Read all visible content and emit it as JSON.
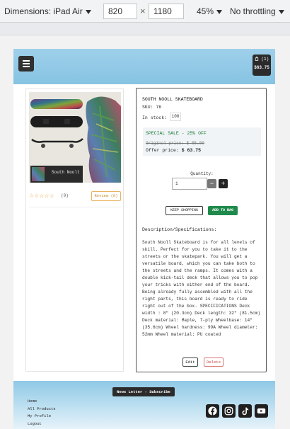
{
  "devtools": {
    "device": "Dimensions: iPad Air",
    "width": "820",
    "separator": "×",
    "height": "1180",
    "zoom": "45%",
    "throttling": "No throttling"
  },
  "header": {
    "cart_count": "(1)",
    "cart_total": "$63.75"
  },
  "product": {
    "image_brand": "South Noolt",
    "rating_count": "(0)",
    "review_button": "Review (0)",
    "name": "SOUTH NOOLL SKATEBOARD",
    "sku": "SKU: 76",
    "stock_label": "In stock:",
    "stock_value": "100",
    "sale_label": "SPECIAL SALE - 25% OFF",
    "original_price": "Original price: $ 85.00",
    "offer_label": "Offer price:",
    "offer_price": "$ 63.75",
    "quantity_label": "Quantity:",
    "quantity_value": "1",
    "minus": "−",
    "plus": "+",
    "keep_shopping": "KEEP SHOPPING",
    "add_to_bag": "ADD TO BAG",
    "description_heading": "Description/Specifications:",
    "description": "South Nooll Skateboard is for all levels of skill. Perfect for you to take it to the streets or the skatepark. You will get a versatile board, which you can take both to the streets and the ramps. It comes with a double kick-tail deck that allows you to pop your tricks with either end of the board. Being already fully assembled with all the right parts, this board is ready to ride right out of the box. SPECIFICATIONS Deck width : 8\" (20.3cm) Deck length: 32\" (81.5cm) Deck material: Maple, 7-ply Wheelbase: 14\" (35.6cm) Wheel hardness: 99A Wheel diameter: 52mm Wheel material: PU coated",
    "edit": "Edit",
    "delete": "Delete"
  },
  "footer": {
    "newsletter": "News Letter - Subscribe",
    "links": [
      "Home",
      "All Products",
      "My Profile",
      "Logout"
    ]
  },
  "colors": {
    "header": "#8cc8e6",
    "sale_green": "#1b7a3a",
    "add_button": "#1f8a4c",
    "review_orange": "#e8b462",
    "delete_red": "#cc4444"
  },
  "icons": [
    "menu-icon",
    "bag-icon",
    "star-icon",
    "facebook-icon",
    "instagram-icon",
    "tiktok-icon",
    "youtube-icon"
  ]
}
